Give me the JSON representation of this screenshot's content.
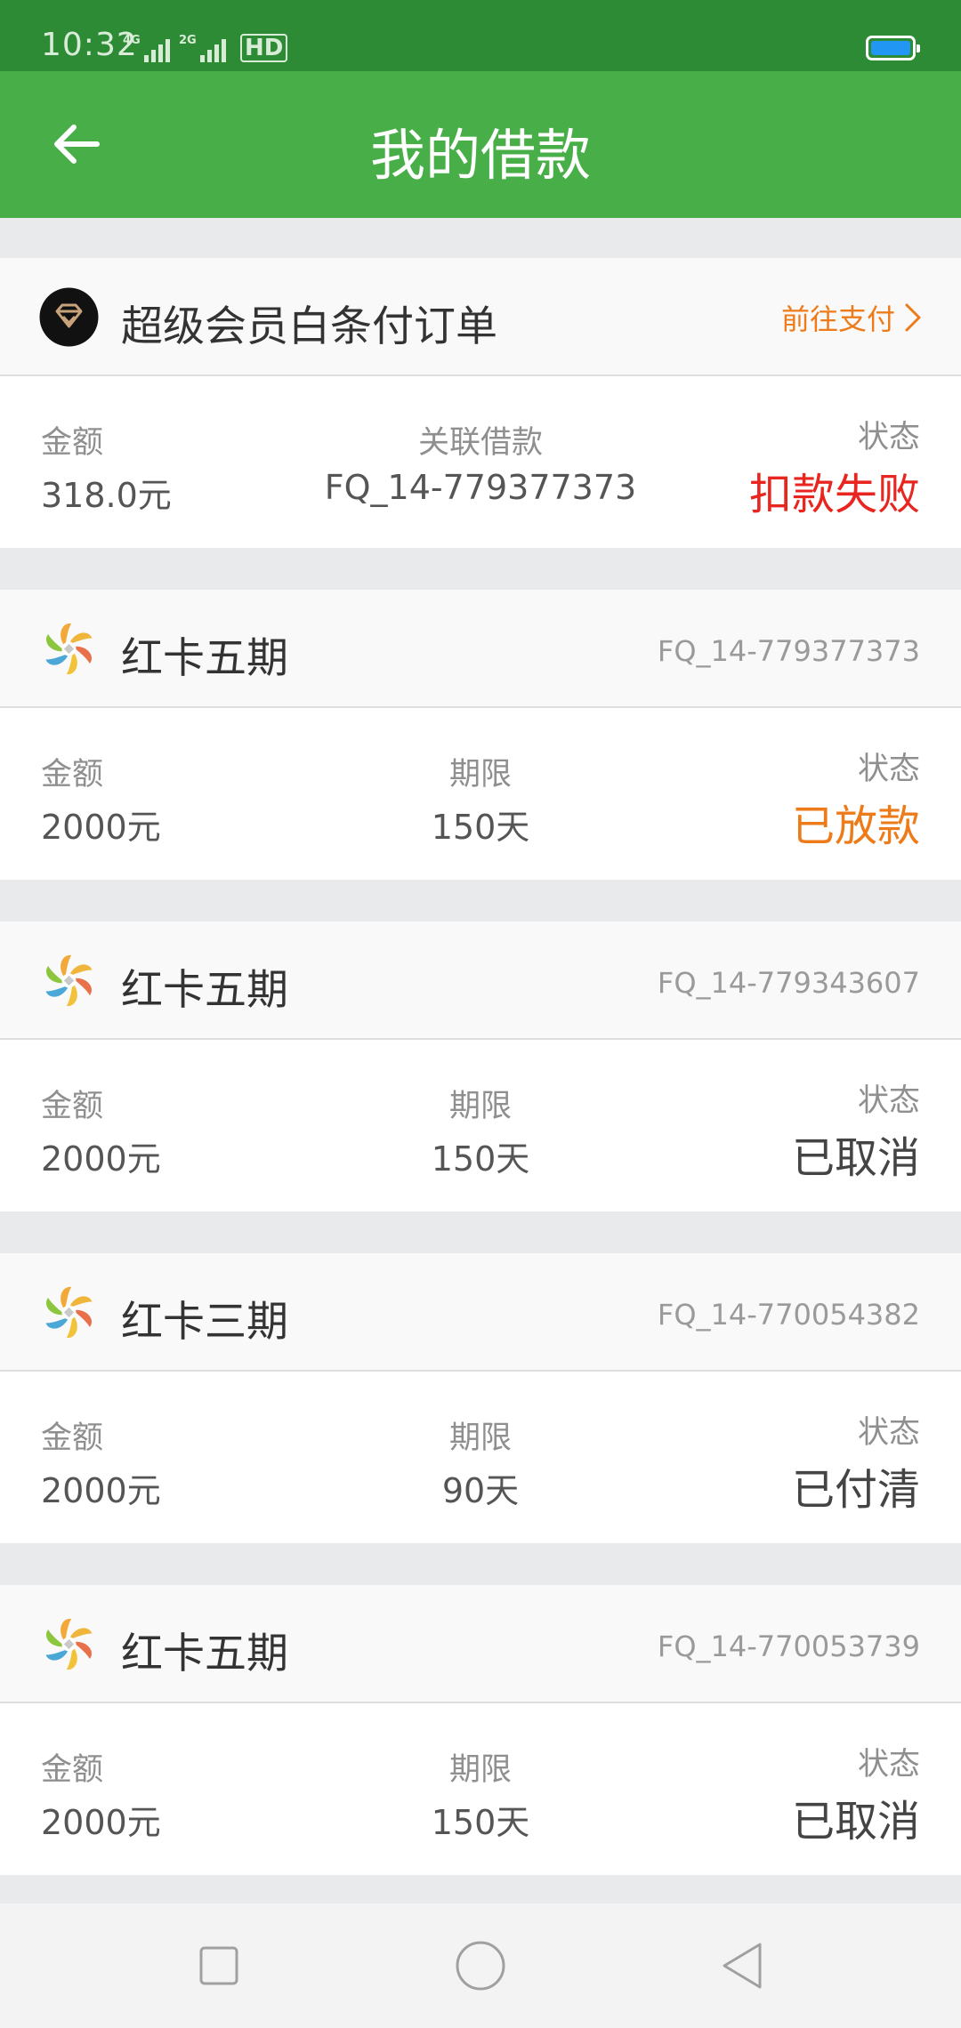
{
  "status_bar": {
    "time": "10:32",
    "signal1_tag": "4G",
    "signal2_tag": "2G",
    "hd_label": "HD",
    "battery_color": "#2196f3"
  },
  "app_bar": {
    "title": "我的借款",
    "back_icon": "arrow-left-icon",
    "background": "#47ae48"
  },
  "colors": {
    "fail": "#e8261f",
    "disbursed": "#ee7b1a",
    "neutral_status": "#444444"
  },
  "vip_order": {
    "title": "超级会员白条付订单",
    "action_label": "前往支付",
    "amount_label": "金额",
    "amount_value": "318.0元",
    "linked_label": "关联借款",
    "linked_value": "FQ_14-779377373",
    "status_label": "状态",
    "status_value": "扣款失败"
  },
  "loans": [
    {
      "name": "红卡五期",
      "code": "FQ_14-779377373",
      "amount_label": "金额",
      "amount_value": "2000元",
      "term_label": "期限",
      "term_value": "150天",
      "status_label": "状态",
      "status_value": "已放款"
    },
    {
      "name": "红卡五期",
      "code": "FQ_14-779343607",
      "amount_label": "金额",
      "amount_value": "2000元",
      "term_label": "期限",
      "term_value": "150天",
      "status_label": "状态",
      "status_value": "已取消"
    },
    {
      "name": "红卡三期",
      "code": "FQ_14-770054382",
      "amount_label": "金额",
      "amount_value": "2000元",
      "term_label": "期限",
      "term_value": "90天",
      "status_label": "状态",
      "status_value": "已付清"
    },
    {
      "name": "红卡五期",
      "code": "FQ_14-770053739",
      "amount_label": "金额",
      "amount_value": "2000元",
      "term_label": "期限",
      "term_value": "150天",
      "status_label": "状态",
      "status_value": "已取消"
    }
  ],
  "nav_bar": {
    "icons": [
      "square-recent-apps-icon",
      "circle-home-icon",
      "triangle-back-icon"
    ]
  }
}
